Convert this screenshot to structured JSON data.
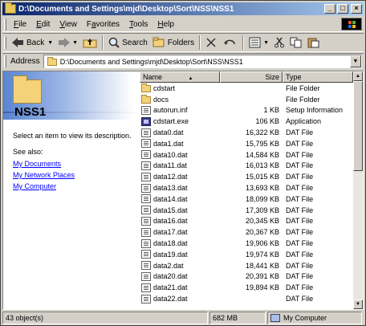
{
  "window": {
    "title": "D:\\Documents and Settings\\mjd\\Desktop\\Sort\\NSS\\NSS1"
  },
  "title_buttons": {
    "minimize": "_",
    "maximize": "□",
    "close": "×"
  },
  "menu": [
    {
      "label": "File",
      "ul": "F",
      "rest": "ile"
    },
    {
      "label": "Edit",
      "ul": "E",
      "rest": "dit"
    },
    {
      "label": "View",
      "ul": "V",
      "rest": "iew"
    },
    {
      "label": "Favorites",
      "ul": "a",
      "pre": "F",
      "rest": "vorites"
    },
    {
      "label": "Tools",
      "ul": "T",
      "rest": "ools"
    },
    {
      "label": "Help",
      "ul": "H",
      "rest": "elp"
    }
  ],
  "toolbar": {
    "back_label": "Back",
    "search_label": "Search",
    "folders_label": "Folders"
  },
  "address": {
    "label": "Address",
    "value": "D:\\Documents and Settings\\mjd\\Desktop\\Sort\\NSS\\NSS1"
  },
  "left_pane": {
    "title": "NSS1",
    "description": "Select an item to view its description.",
    "see_also": "See also:",
    "links": [
      "My Documents",
      "My Network Places",
      "My Computer"
    ]
  },
  "columns": {
    "name": "Name",
    "size": "Size",
    "type": "Type",
    "sort_indicator": "▲"
  },
  "files": [
    {
      "name": "cdstart",
      "size": "",
      "type": "File Folder",
      "icon": "folder"
    },
    {
      "name": "docs",
      "size": "",
      "type": "File Folder",
      "icon": "folder"
    },
    {
      "name": "autorun.inf",
      "size": "1 KB",
      "type": "Setup Information",
      "icon": "doc"
    },
    {
      "name": "cdstart.exe",
      "size": "106 KB",
      "type": "Application",
      "icon": "exe"
    },
    {
      "name": "data0.dat",
      "size": "16,322 KB",
      "type": "DAT File",
      "icon": "doc"
    },
    {
      "name": "data1.dat",
      "size": "15,795 KB",
      "type": "DAT File",
      "icon": "doc"
    },
    {
      "name": "data10.dat",
      "size": "14,584 KB",
      "type": "DAT File",
      "icon": "doc"
    },
    {
      "name": "data11.dat",
      "size": "16,013 KB",
      "type": "DAT File",
      "icon": "doc"
    },
    {
      "name": "data12.dat",
      "size": "15,015 KB",
      "type": "DAT File",
      "icon": "doc"
    },
    {
      "name": "data13.dat",
      "size": "13,693 KB",
      "type": "DAT File",
      "icon": "doc"
    },
    {
      "name": "data14.dat",
      "size": "18,099 KB",
      "type": "DAT File",
      "icon": "doc"
    },
    {
      "name": "data15.dat",
      "size": "17,309 KB",
      "type": "DAT File",
      "icon": "doc"
    },
    {
      "name": "data16.dat",
      "size": "20,345 KB",
      "type": "DAT File",
      "icon": "doc"
    },
    {
      "name": "data17.dat",
      "size": "20,367 KB",
      "type": "DAT File",
      "icon": "doc"
    },
    {
      "name": "data18.dat",
      "size": "19,906 KB",
      "type": "DAT File",
      "icon": "doc"
    },
    {
      "name": "data19.dat",
      "size": "19,974 KB",
      "type": "DAT File",
      "icon": "doc"
    },
    {
      "name": "data2.dat",
      "size": "18,441 KB",
      "type": "DAT File",
      "icon": "doc"
    },
    {
      "name": "data20.dat",
      "size": "20,391 KB",
      "type": "DAT File",
      "icon": "doc"
    },
    {
      "name": "data21.dat",
      "size": "19,894 KB",
      "type": "DAT File",
      "icon": "doc"
    },
    {
      "name": "data22.dat",
      "size": "",
      "type": "DAT File",
      "icon": "doc"
    }
  ],
  "status": {
    "objects": "43 object(s)",
    "size": "682 MB",
    "zone": "My Computer"
  }
}
